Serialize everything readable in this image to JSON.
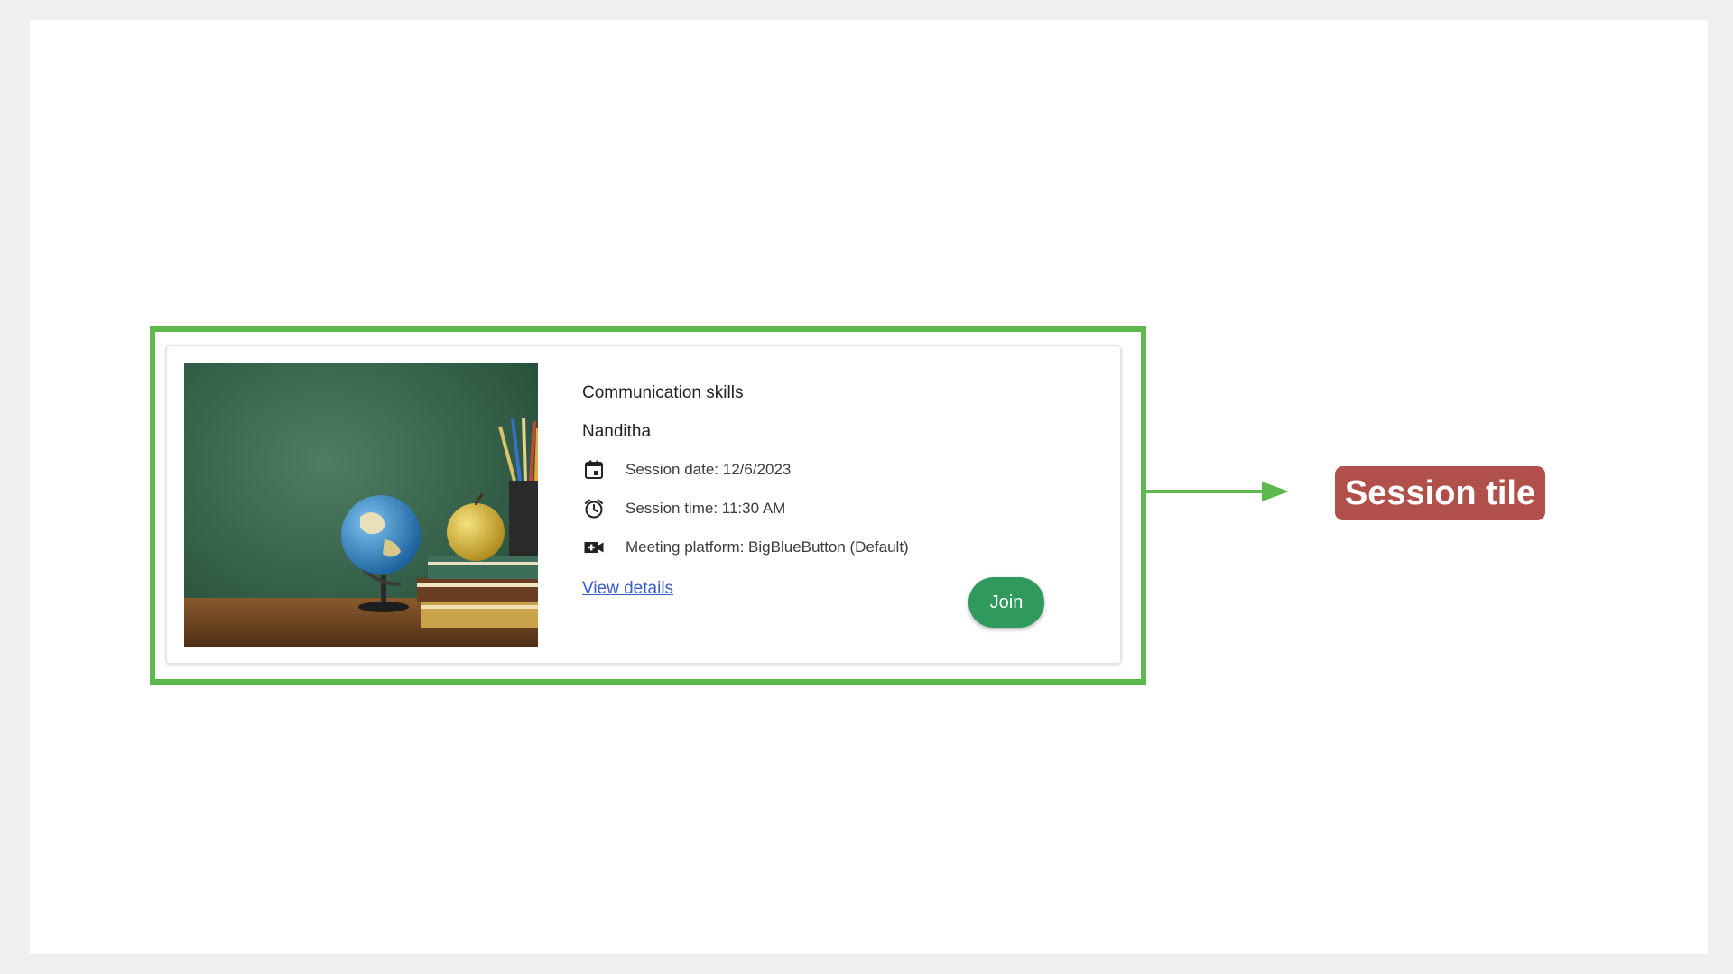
{
  "session_tile": {
    "title": "Communication skills",
    "host": "Nanditha",
    "date_text": "Session date: 12/6/2023",
    "time_text": "Session time: 11:30 AM",
    "platform_text": "Meeting platform: BigBlueButton (Default)",
    "view_details_label": "View details",
    "join_label": "Join",
    "icons": {
      "date": "calendar-icon",
      "time": "alarm-clock-icon",
      "platform": "video-camera-icon"
    }
  },
  "annotation": {
    "callout_label": "Session tile"
  },
  "colors": {
    "highlight": "#5db84e",
    "join_button": "#2f9a5c",
    "callout_bg": "#b14f4a",
    "link": "#3a5bc7"
  }
}
